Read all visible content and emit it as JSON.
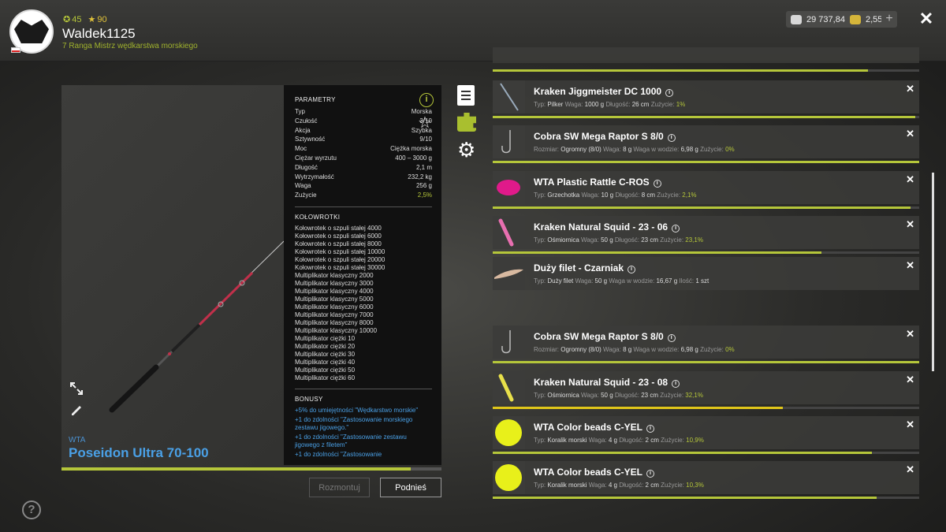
{
  "player": {
    "level": "45",
    "stars": "90",
    "name": "Waldek1125",
    "rank": "7 Ranga Mistrz wędkarstwa morskiego"
  },
  "currency": {
    "silver": "29 737,84",
    "gold": "2,55",
    "plus_label": "+",
    "close_label": "✕"
  },
  "rod": {
    "brand": "WTA",
    "name": "Poseidon Ultra 70-100",
    "wear_fraction": 0.92
  },
  "params": {
    "heading": "PARAMETRY",
    "rows": [
      {
        "label": "Typ",
        "value": "Morska"
      },
      {
        "label": "Czułość",
        "value": "3/10"
      },
      {
        "label": "Akcja",
        "value": "Szybka"
      },
      {
        "label": "Sztywność",
        "value": "9/10"
      },
      {
        "label": "Moc",
        "value": "Ciężka morska"
      },
      {
        "label": "Ciężar wyrzutu",
        "value": "400 – 3000 g"
      },
      {
        "label": "Długość",
        "value": "2,1 m"
      },
      {
        "label": "Wytrzymałość",
        "value": "232,2 kg"
      },
      {
        "label": "Waga",
        "value": "256 g"
      },
      {
        "label": "Zużycie",
        "value": "2,5%"
      }
    ]
  },
  "reels": {
    "heading": "KOŁOWROTKI",
    "items": [
      "Kołowrotek o szpuli stałej 4000",
      "Kołowrotek o szpuli stałej 6000",
      "Kołowrotek o szpuli stałej 8000",
      "Kołowrotek o szpuli stałej 10000",
      "Kołowrotek o szpuli stałej 20000",
      "Kołowrotek o szpuli stałej 30000",
      "Multiplikator klasyczny 2000",
      "Multiplikator klasyczny 3000",
      "Multiplikator klasyczny 4000",
      "Multiplikator klasyczny 5000",
      "Multiplikator klasyczny 6000",
      "Multiplikator klasyczny 7000",
      "Multiplikator klasyczny 8000",
      "Multiplikator klasyczny 10000",
      "Multiplikator ciężki 10",
      "Multiplikator ciężki 20",
      "Multiplikator ciężki 30",
      "Multiplikator ciężki 40",
      "Multiplikator ciężki 50",
      "Multiplikator ciężki 60"
    ]
  },
  "bonuses": {
    "heading": "BONUSY",
    "items": [
      "+5% do umiejętności \"Wędkarstwo morskie\"",
      "+1 do zdolności \"Zastosowanie morskiego zestawu jigowego.\"",
      "+1 do zdolności \"Zastosowanie zestawu jigowego z filetem\"",
      "+1 do zdolności \"Zastosowanie"
    ]
  },
  "buttons": {
    "unmount": "Rozmontuj",
    "lift": "Podnieś"
  },
  "help_label": "?",
  "tackle": [
    {
      "name": "Kraken Jiggmeister DC 1000",
      "meta": [
        [
          "Typ:",
          "Pilker"
        ],
        [
          "Waga:",
          "1000 g"
        ],
        [
          "Długość:",
          "26 cm"
        ],
        [
          "Zużycie:",
          "1%"
        ]
      ],
      "wear": 0.99,
      "thumb": "jig",
      "bar_color": "green"
    },
    {
      "name": "Cobra SW Mega Raptor S 8/0",
      "meta": [
        [
          "Rozmiar:",
          "Ogromny (8/0)"
        ],
        [
          "Waga:",
          "8 g"
        ],
        [
          "Waga w wodzie:",
          "6,98 g"
        ],
        [
          "Zużycie:",
          "0%"
        ]
      ],
      "wear": 1.0,
      "thumb": "hook",
      "bar_color": "green"
    },
    {
      "name": "WTA Plastic Rattle C-ROS",
      "meta": [
        [
          "Typ:",
          "Grzechotka"
        ],
        [
          "Waga:",
          "10 g"
        ],
        [
          "Długość:",
          "8 cm"
        ],
        [
          "Zużycie:",
          "2,1%"
        ]
      ],
      "wear": 0.98,
      "thumb": "rattle",
      "bar_color": "green"
    },
    {
      "name": "Kraken Natural Squid - 23 - 06",
      "meta": [
        [
          "Typ:",
          "Ośmiornica"
        ],
        [
          "Waga:",
          "50 g"
        ],
        [
          "Długość:",
          "23 cm"
        ],
        [
          "Zużycie:",
          "23,1%"
        ]
      ],
      "wear": 0.77,
      "thumb": "squid-pink",
      "bar_color": "green"
    },
    {
      "name": "Duży filet - Czarniak",
      "meta": [
        [
          "Typ:",
          "Duży filet"
        ],
        [
          "Waga:",
          "50 g"
        ],
        [
          "Waga w wodzie:",
          "16,67 g"
        ],
        [
          "Ilość:",
          "1 szt"
        ]
      ],
      "wear": null,
      "thumb": "fillet",
      "bar_color": "none"
    },
    {
      "name": "Cobra SW Mega Raptor S 8/0",
      "meta": [
        [
          "Rozmiar:",
          "Ogromny (8/0)"
        ],
        [
          "Waga:",
          "8 g"
        ],
        [
          "Waga w wodzie:",
          "6,98 g"
        ],
        [
          "Zużycie:",
          "0%"
        ]
      ],
      "wear": 1.0,
      "thumb": "hook",
      "bar_color": "green"
    },
    {
      "name": "Kraken Natural Squid - 23 - 08",
      "meta": [
        [
          "Typ:",
          "Ośmiornica"
        ],
        [
          "Waga:",
          "50 g"
        ],
        [
          "Długość:",
          "23 cm"
        ],
        [
          "Zużycie:",
          "32,1%"
        ]
      ],
      "wear": 0.68,
      "thumb": "squid-yellow",
      "bar_color": "yellow"
    },
    {
      "name": "WTA Color beads C-YEL",
      "meta": [
        [
          "Typ:",
          "Koralik morski"
        ],
        [
          "Waga:",
          "4 g"
        ],
        [
          "Długość:",
          "2 cm"
        ],
        [
          "Zużycie:",
          "10,9%"
        ]
      ],
      "wear": 0.89,
      "thumb": "bead",
      "bar_color": "green"
    },
    {
      "name": "WTA Color beads C-YEL",
      "meta": [
        [
          "Typ:",
          "Koralik morski"
        ],
        [
          "Waga:",
          "4 g"
        ],
        [
          "Długość:",
          "2 cm"
        ],
        [
          "Zużycie:",
          "10,3%"
        ]
      ],
      "wear": 0.9,
      "thumb": "bead",
      "bar_color": "green"
    }
  ],
  "colors": {
    "accent_green": "#b5c63a",
    "accent_blue": "#4aa0e6",
    "wear_yellow": "#e0c61a"
  }
}
